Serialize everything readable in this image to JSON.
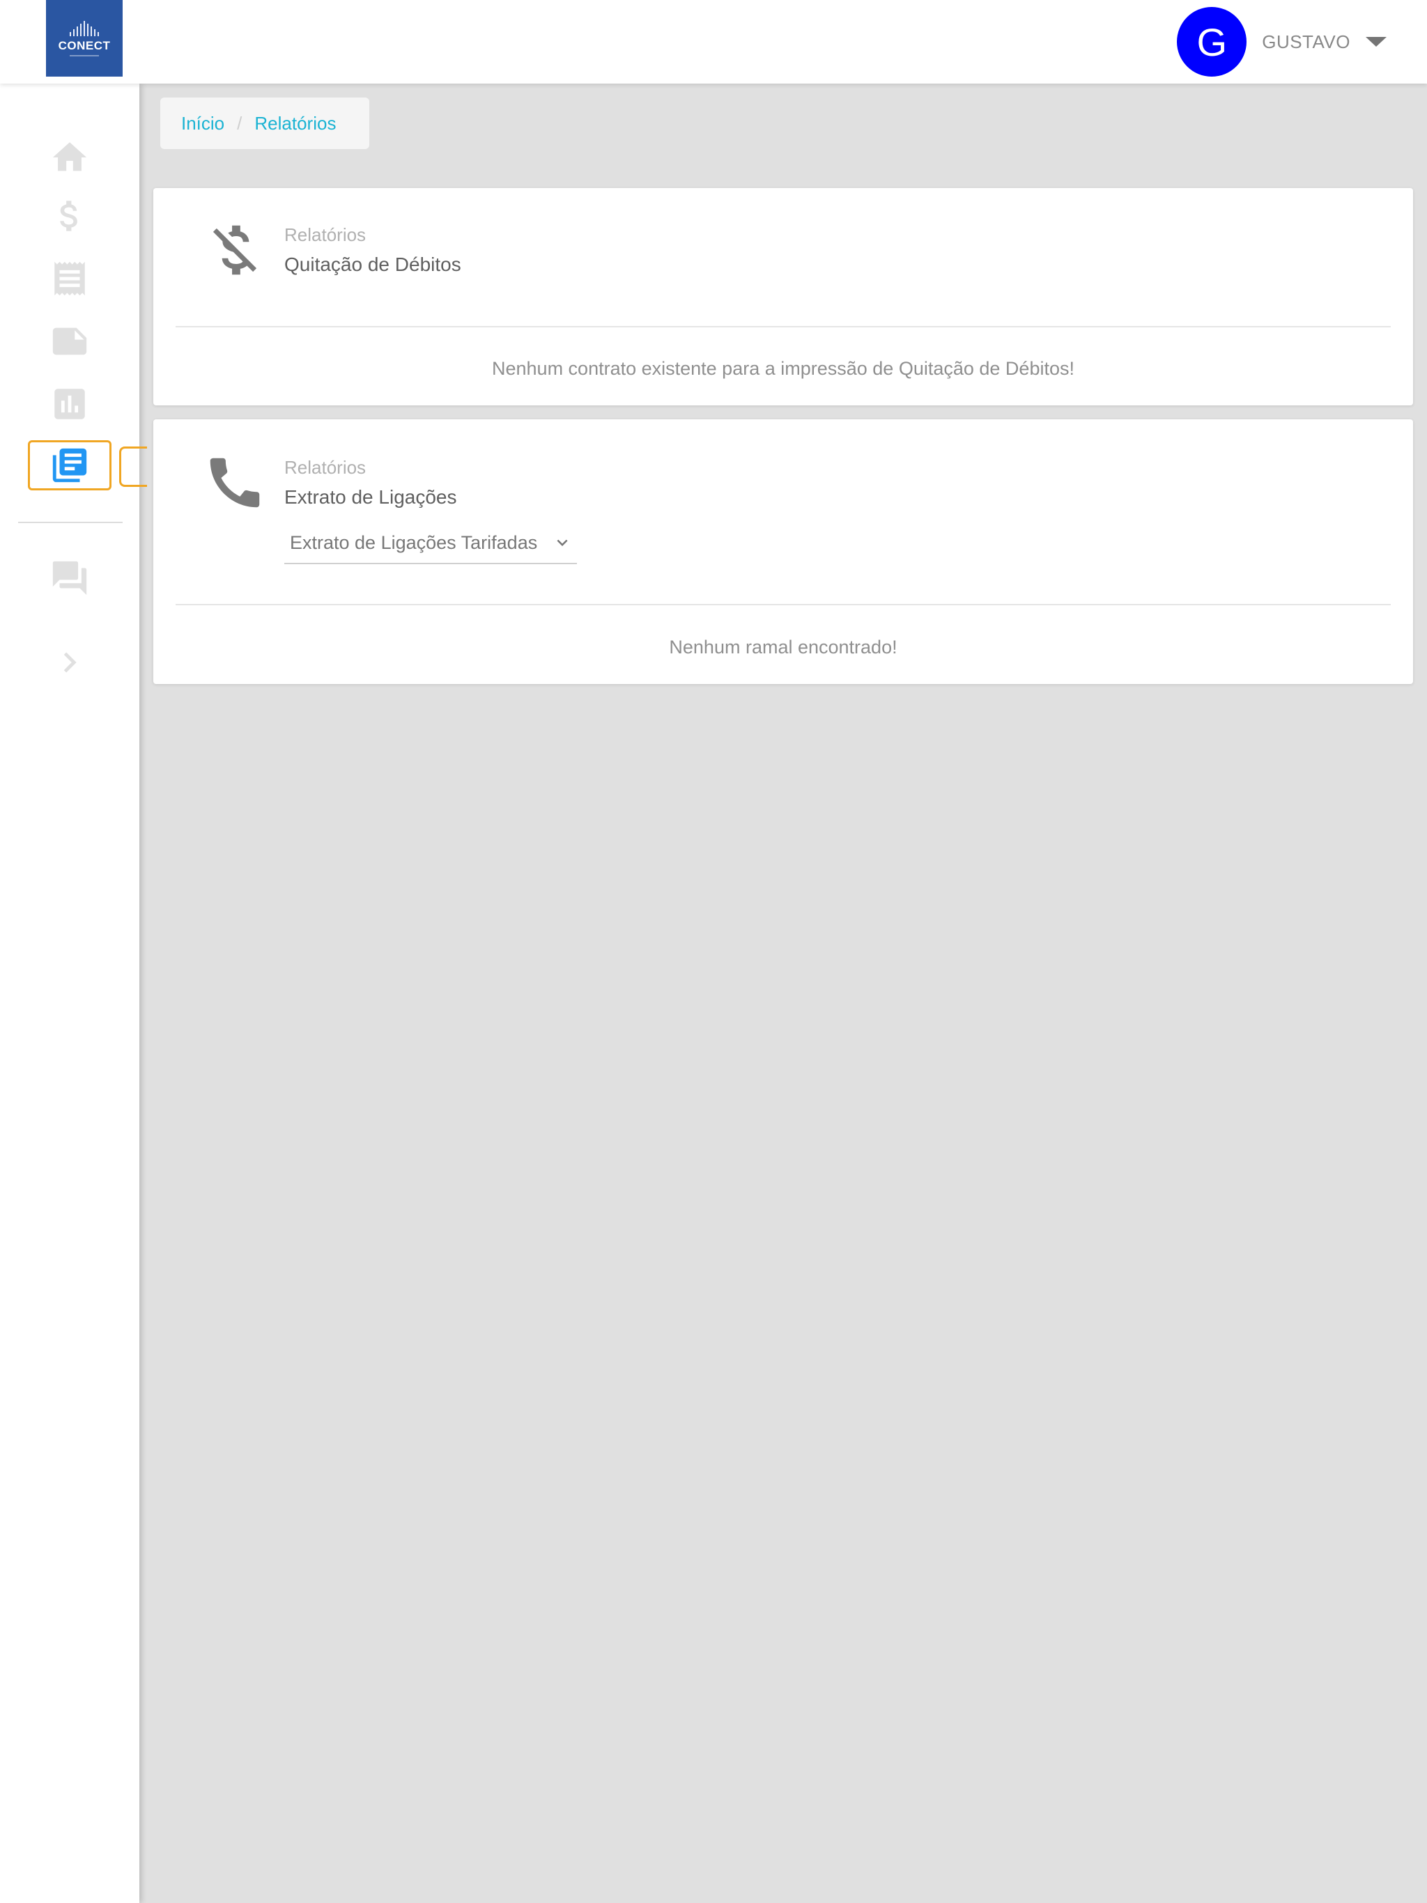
{
  "header": {
    "logo_text": "CONECT",
    "avatar_letter": "G",
    "user_name": "GUSTAVO"
  },
  "sidebar": {
    "items": [
      {
        "name": "home",
        "icon": "home-icon"
      },
      {
        "name": "financeiro",
        "icon": "dollar-icon"
      },
      {
        "name": "faturas",
        "icon": "receipt-icon"
      },
      {
        "name": "notas",
        "icon": "note-icon"
      },
      {
        "name": "graficos",
        "icon": "bar-chart-icon"
      },
      {
        "name": "relatorios",
        "icon": "reports-icon",
        "active": true
      },
      {
        "name": "mensagens",
        "icon": "forum-icon"
      },
      {
        "name": "expandir",
        "icon": "chevron-right-icon"
      }
    ],
    "active_color": "#2196f3",
    "inactive_color": "#e0e0e0"
  },
  "breadcrumb": {
    "items": [
      "Início",
      "Relatórios"
    ],
    "separator": "/"
  },
  "cards": {
    "debts": {
      "icon": "money-off-icon",
      "subtitle": "Relatórios",
      "title": "Quitação de Débitos",
      "message": "Nenhum contrato existente para a impressão de Quitação de Débitos!"
    },
    "calls": {
      "icon": "phone-icon",
      "subtitle": "Relatórios",
      "title": "Extrato de Ligações",
      "select_value": "Extrato de Ligações Tarifadas",
      "message": "Nenhum ramal encontrado!"
    }
  },
  "colors": {
    "accent": "#1bb3d3",
    "avatar": "#0000ff",
    "brand": "#2a56a2",
    "highlight": "#f0a623"
  }
}
